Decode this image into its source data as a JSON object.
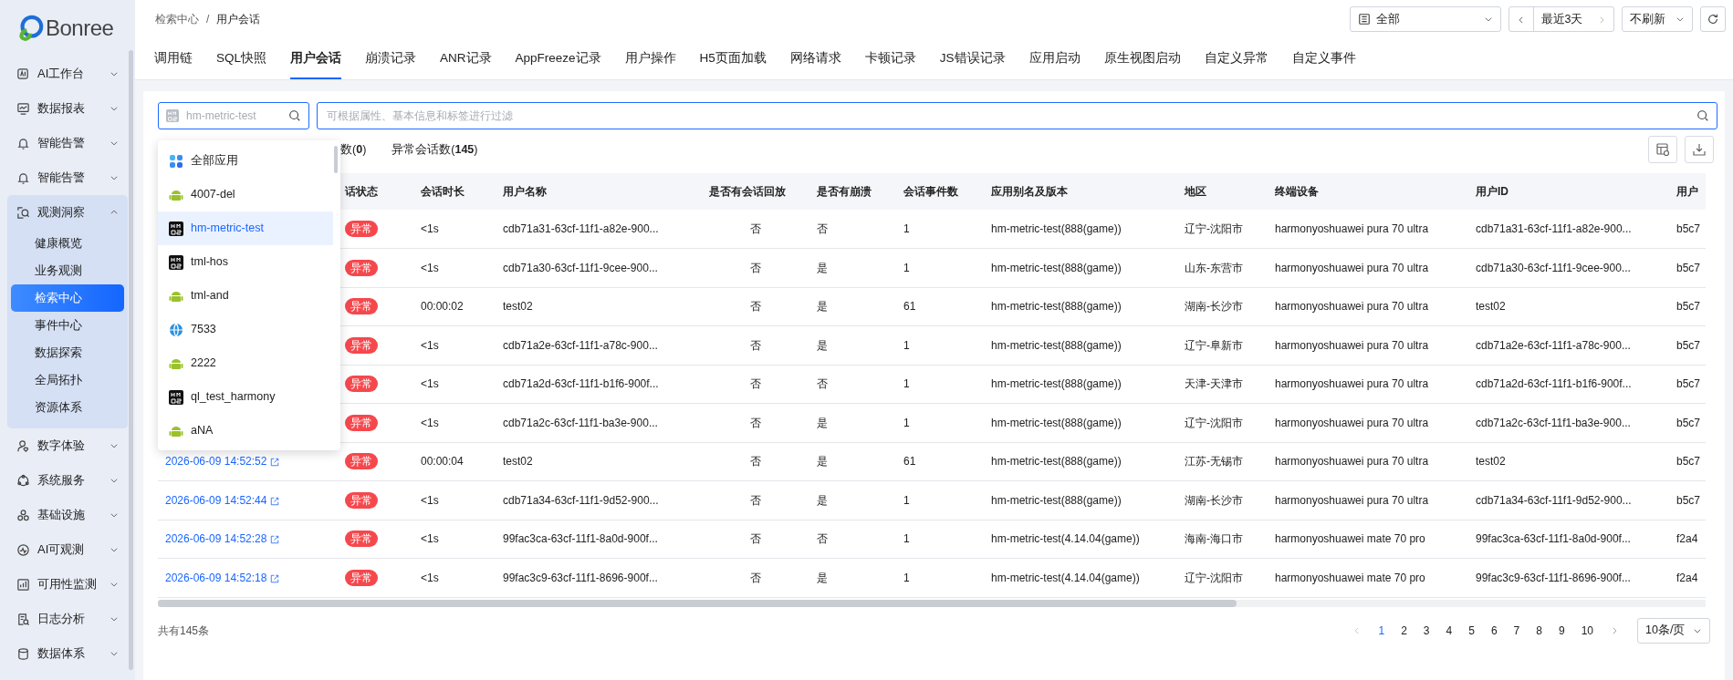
{
  "sidebar": {
    "logo": "Bonree",
    "items": [
      {
        "label": "AI工作台",
        "expanded": false
      },
      {
        "label": "数据报表",
        "expanded": false
      },
      {
        "label": "智能告警",
        "expanded": false
      },
      {
        "label": "智能告警",
        "expanded": false
      },
      {
        "label": "观测洞察",
        "expanded": true,
        "children": [
          {
            "label": "健康概览",
            "selected": false
          },
          {
            "label": "业务观测",
            "selected": false
          },
          {
            "label": "检索中心",
            "selected": true
          },
          {
            "label": "事件中心",
            "selected": false
          },
          {
            "label": "数据探索",
            "selected": false
          },
          {
            "label": "全局拓扑",
            "selected": false
          },
          {
            "label": "资源体系",
            "selected": false
          }
        ]
      },
      {
        "label": "数字体验",
        "expanded": false
      },
      {
        "label": "系统服务",
        "expanded": false
      },
      {
        "label": "基础设施",
        "expanded": false
      },
      {
        "label": "AI可观测",
        "expanded": false
      },
      {
        "label": "可用性监测",
        "expanded": false
      },
      {
        "label": "日志分析",
        "expanded": false
      },
      {
        "label": "数据体系",
        "expanded": false
      }
    ]
  },
  "breadcrumb": [
    "检索中心",
    "用户会话"
  ],
  "breadcrumb_separator": "/",
  "app_filter": {
    "value": "全部"
  },
  "time_range": {
    "value": "最近3天"
  },
  "refresh": {
    "value": "不刷新"
  },
  "tabs": [
    {
      "label": "调用链",
      "selected": false
    },
    {
      "label": "SQL快照",
      "selected": false
    },
    {
      "label": "用户会话",
      "selected": true
    },
    {
      "label": "崩溃记录",
      "selected": false
    },
    {
      "label": "ANR记录",
      "selected": false
    },
    {
      "label": "AppFreeze记录",
      "selected": false
    },
    {
      "label": "用户操作",
      "selected": false
    },
    {
      "label": "H5页面加载",
      "selected": false
    },
    {
      "label": "网络请求",
      "selected": false
    },
    {
      "label": "卡顿记录",
      "selected": false
    },
    {
      "label": "JS错误记录",
      "selected": false
    },
    {
      "label": "应用启动",
      "selected": false
    },
    {
      "label": "原生视图启动",
      "selected": false
    },
    {
      "label": "自定义异常",
      "selected": false
    },
    {
      "label": "自定义事件",
      "selected": false
    }
  ],
  "app_search": {
    "placeholder": "hm-metric-test"
  },
  "filter_search": {
    "placeholder": "可根据属性、基本信息和标签进行过滤"
  },
  "app_dropdown": [
    {
      "label": "全部应用",
      "kind": "all",
      "selected": false
    },
    {
      "label": "4007-del",
      "kind": "android",
      "selected": false
    },
    {
      "label": "hm-metric-test",
      "kind": "harmony",
      "selected": true
    },
    {
      "label": "tml-hos",
      "kind": "harmony",
      "selected": false
    },
    {
      "label": "tml-and",
      "kind": "android",
      "selected": false
    },
    {
      "label": "7533",
      "kind": "web",
      "selected": false
    },
    {
      "label": "2222",
      "kind": "android",
      "selected": false
    },
    {
      "label": "ql_test_harmony",
      "kind": "harmony",
      "selected": false
    },
    {
      "label": "aNA",
      "kind": "android",
      "selected": false
    }
  ],
  "session_tabs": [
    {
      "label": "数(**0**)"
    },
    {
      "label": "异常会话数(**145**)"
    }
  ],
  "table": {
    "columns": [
      "话状态",
      "会话时长",
      "用户名称",
      "是否有会话回放",
      "是否有崩溃",
      "会话事件数",
      "应用别名及版本",
      "地区",
      "终端设备",
      "用户ID",
      "用户"
    ],
    "rows": [
      {
        "status": "异常",
        "duration": "<1s",
        "user_name": "cdb71a31-63cf-11f1-a82e-900...",
        "replay": "否",
        "crash": "否",
        "events": "1",
        "app": "hm-metric-test(888(game))",
        "region": "辽宁-沈阳市",
        "device": "harmonyoshuawei pura 70 ultra",
        "user_id": "cdb71a31-63cf-11f1-a82e-900...",
        "column_12": "b5c7"
      },
      {
        "status": "异常",
        "duration": "<1s",
        "user_name": "cdb71a30-63cf-11f1-9cee-900...",
        "replay": "否",
        "crash": "是",
        "events": "1",
        "app": "hm-metric-test(888(game))",
        "region": "山东-东营市",
        "device": "harmonyoshuawei pura 70 ultra",
        "user_id": "cdb71a30-63cf-11f1-9cee-900...",
        "column_12": "b5c7"
      },
      {
        "status": "异常",
        "duration": "00:00:02",
        "user_name": "test02",
        "replay": "否",
        "crash": "是",
        "events": "61",
        "app": "hm-metric-test(888(game))",
        "region": "湖南-长沙市",
        "device": "harmonyoshuawei pura 70 ultra",
        "user_id": "test02",
        "column_12": "b5c7"
      },
      {
        "status": "异常",
        "duration": "<1s",
        "user_name": "cdb71a2e-63cf-11f1-a78c-900...",
        "replay": "否",
        "crash": "是",
        "events": "1",
        "app": "hm-metric-test(888(game))",
        "region": "辽宁-阜新市",
        "device": "harmonyoshuawei pura 70 ultra",
        "user_id": "cdb71a2e-63cf-11f1-a78c-900...",
        "column_12": "b5c7"
      },
      {
        "status": "异常",
        "duration": "<1s",
        "user_name": "cdb71a2d-63cf-11f1-b1f6-900f...",
        "replay": "否",
        "crash": "否",
        "events": "1",
        "app": "hm-metric-test(888(game))",
        "region": "天津-天津市",
        "device": "harmonyoshuawei pura 70 ultra",
        "user_id": "cdb71a2d-63cf-11f1-b1f6-900f...",
        "column_12": "b5c7"
      },
      {
        "status": "异常",
        "duration": "<1s",
        "user_name": "cdb71a2c-63cf-11f1-ba3e-900...",
        "replay": "否",
        "crash": "是",
        "events": "1",
        "app": "hm-metric-test(888(game))",
        "region": "辽宁-沈阳市",
        "device": "harmonyoshuawei pura 70 ultra",
        "user_id": "cdb71a2c-63cf-11f1-ba3e-900...",
        "column_12": "b5c7"
      },
      {
        "time": "2026-06-09 14:52:52",
        "status": "异常",
        "duration": "00:00:04",
        "user_name": "test02",
        "replay": "否",
        "crash": "是",
        "events": "61",
        "app": "hm-metric-test(888(game))",
        "region": "江苏-无锡市",
        "device": "harmonyoshuawei pura 70 ultra",
        "user_id": "test02",
        "column_12": "b5c7"
      },
      {
        "time": "2026-06-09 14:52:44",
        "status": "异常",
        "duration": "<1s",
        "user_name": "cdb71a34-63cf-11f1-9d52-900...",
        "replay": "否",
        "crash": "是",
        "events": "1",
        "app": "hm-metric-test(888(game))",
        "region": "湖南-长沙市",
        "device": "harmonyoshuawei pura 70 ultra",
        "user_id": "cdb71a34-63cf-11f1-9d52-900...",
        "column_12": "b5c7"
      },
      {
        "time": "2026-06-09 14:52:28",
        "status": "异常",
        "duration": "<1s",
        "user_name": "99fac3ca-63cf-11f1-8a0d-900f...",
        "replay": "否",
        "crash": "否",
        "events": "1",
        "app": "hm-metric-test(4.14.04(game))",
        "region": "海南-海口市",
        "device": "harmonyoshuawei mate 70 pro",
        "user_id": "99fac3ca-63cf-11f1-8a0d-900f...",
        "column_12": "f2a4"
      },
      {
        "time": "2026-06-09 14:52:18",
        "status": "异常",
        "duration": "<1s",
        "user_name": "99fac3c9-63cf-11f1-8696-900f...",
        "replay": "否",
        "crash": "是",
        "events": "1",
        "app": "hm-metric-test(4.14.04(game))",
        "region": "辽宁-沈阳市",
        "device": "harmonyoshuawei mate 70 pro",
        "user_id": "99fac3c9-63cf-11f1-8696-900f...",
        "column_12": "f2a4"
      }
    ]
  },
  "footer": {
    "total": "共有145条",
    "pages": [
      {
        "label": "1",
        "selected": true
      },
      {
        "label": "2",
        "selected": false
      },
      {
        "label": "3",
        "selected": false
      },
      {
        "label": "4",
        "selected": false
      },
      {
        "label": "5",
        "selected": false
      },
      {
        "label": "6",
        "selected": false
      },
      {
        "label": "7",
        "selected": false
      },
      {
        "label": "8",
        "selected": false
      },
      {
        "label": "9",
        "selected": false
      },
      {
        "label": "10",
        "selected": false
      }
    ],
    "page_size": "10条/页"
  }
}
